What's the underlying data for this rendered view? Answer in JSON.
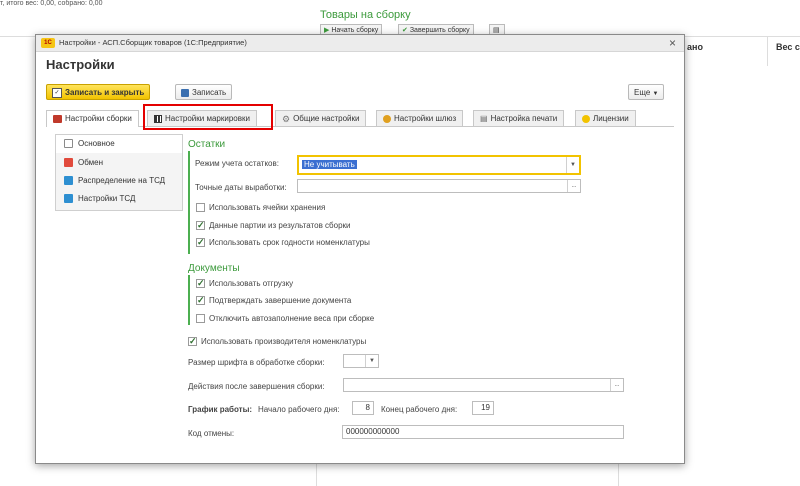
{
  "background": {
    "top_line": "т, итого вес: 0,00, собрано: 0,00",
    "title": "Товары на сборку",
    "start_button": "Начать сборку",
    "finish_button": "Завершить сборку",
    "columns": [
      "ано",
      "Вес с"
    ]
  },
  "window": {
    "title": "Настройки - АСП.Сборщик товаров (1С:Предприятие)",
    "logo": "1С",
    "heading": "Настройки"
  },
  "toolbar": {
    "save_close": "Записать и закрыть",
    "save": "Записать",
    "more": "Еще"
  },
  "tabs": [
    {
      "label": "Настройки сборки"
    },
    {
      "label": "Настройки маркировки"
    },
    {
      "label": "Общие настройки"
    },
    {
      "label": "Настройки шлюз"
    },
    {
      "label": "Настройка печати"
    },
    {
      "label": "Лицензии"
    }
  ],
  "side_menu": [
    {
      "label": "Основное",
      "color": "#8a8a8a"
    },
    {
      "label": "Обмен",
      "color": "#e14a3c"
    },
    {
      "label": "Распределение на ТСД",
      "color": "#2d8fd1"
    },
    {
      "label": "Настройки ТСД",
      "color": "#2d8fd1"
    }
  ],
  "remains": {
    "title": "Остатки",
    "mode_label": "Режим учета остатков:",
    "mode_value": "Не учитывать",
    "dates_label": "Точные даты выработки:",
    "dates_value": "",
    "use_cells": "Использовать ячейки хранения",
    "use_cells_checked": false,
    "batch_data": "Данные партии из результатов сборки",
    "batch_data_checked": true,
    "expiry": "Использовать срок годности номенклатуры",
    "expiry_checked": true
  },
  "documents": {
    "title": "Документы",
    "shipment": "Использовать отгрузку",
    "shipment_checked": true,
    "confirm": "Подтверждать завершение документа",
    "confirm_checked": true,
    "disable_weight": "Отключить автозаполнение веса при сборке",
    "disable_weight_checked": false
  },
  "general": {
    "use_manufacturer": "Использовать производителя номенклатуры",
    "use_manufacturer_checked": true,
    "font_size_label": "Размер шрифта в обработке сборки:",
    "font_size_value": "",
    "actions_label": "Действия после завершения сборки:",
    "actions_value": "",
    "schedule_label": "График работы:",
    "start_label": "Начало рабочего дня:",
    "start_value": "8",
    "end_label": "Конец рабочего дня:",
    "end_value": "19",
    "cancel_code_label": "Код отмены:",
    "cancel_code_value": "000000000000"
  },
  "colors": {
    "accent_green": "#3c9a3c",
    "highlight_red": "#e40000",
    "button_yellow": "#f2c300",
    "focus_yellow": "#f2c300"
  }
}
